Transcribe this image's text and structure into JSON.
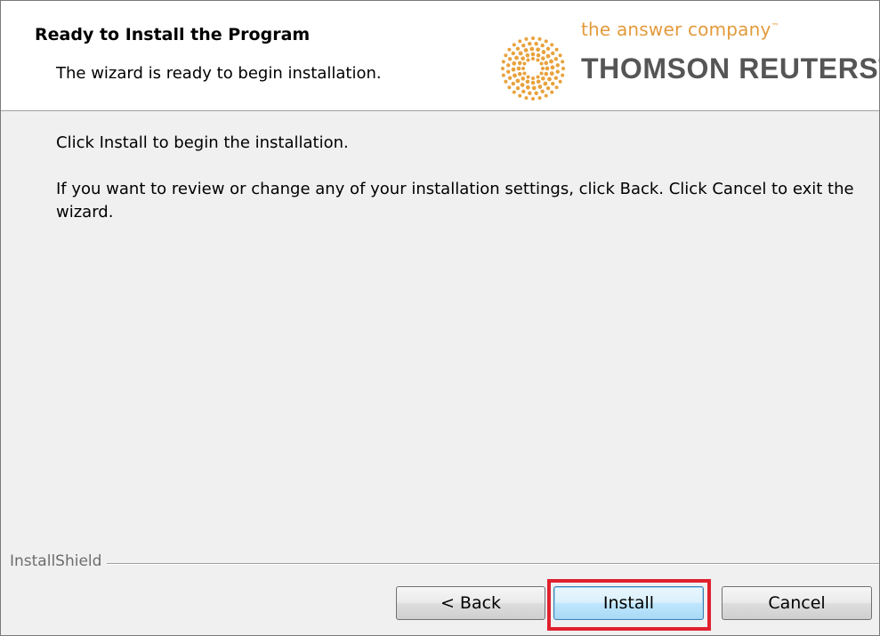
{
  "header": {
    "title": "Ready to Install the Program",
    "subtitle": "The wizard is ready to begin installation."
  },
  "logo": {
    "tagline": "the answer company",
    "tagline_mark": "™",
    "name": "THOMSON REUTERS",
    "name_mark": "®",
    "icon": "thomson-reuters-dot-globe-icon",
    "color_tagline": "#e39a3b",
    "color_dots": "#e8a23d"
  },
  "content": {
    "line1": "Click Install to begin the installation.",
    "line2": "If you want to review or change any of your installation settings, click Back. Click Cancel to exit the wizard."
  },
  "footer": {
    "brand": "InstallShield"
  },
  "buttons": {
    "back": "< Back",
    "install": "Install",
    "cancel": "Cancel"
  },
  "colors": {
    "highlight": "#e0202e",
    "default_button_border": "#3c7fb1"
  }
}
